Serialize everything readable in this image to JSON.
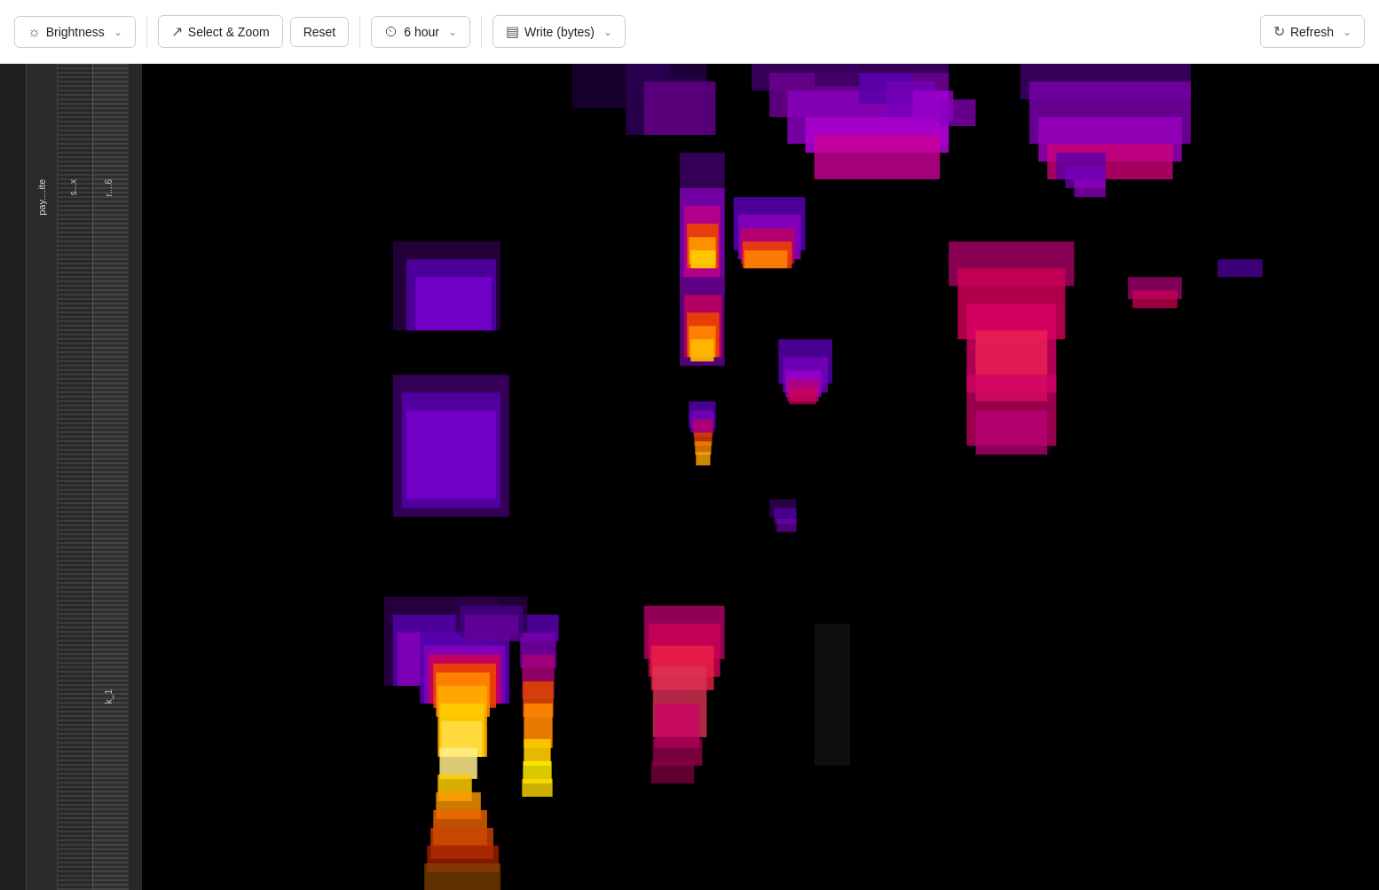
{
  "toolbar": {
    "brightness_label": "Brightness",
    "select_zoom_label": "Select & Zoom",
    "reset_label": "Reset",
    "time_label": "6 hour",
    "metric_label": "Write (bytes)",
    "refresh_label": "Refresh"
  },
  "sidebar": {
    "labels": [
      "s...x",
      "pay....ite",
      "r....6",
      "k_1"
    ]
  },
  "heatmap": {
    "background": "#000000"
  }
}
